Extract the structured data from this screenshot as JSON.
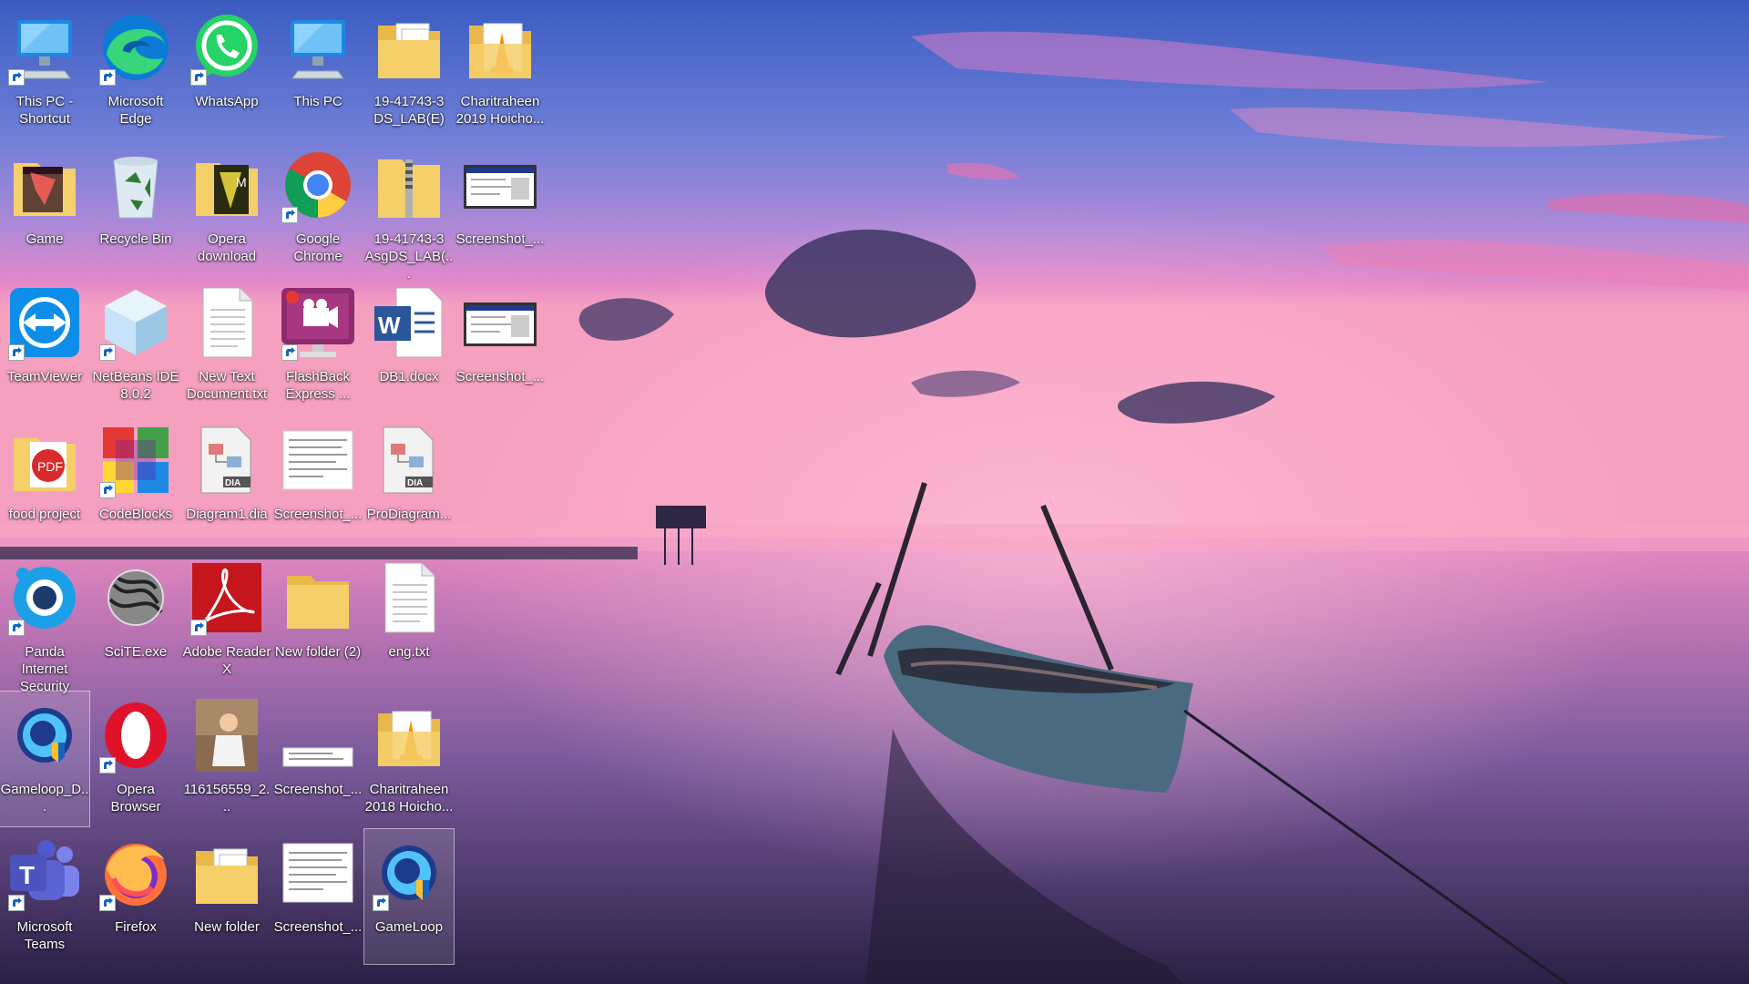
{
  "desktop": {
    "wallpaper": {
      "sky_top": "#3f5fb8",
      "sky_mid": "#b58ad6",
      "horizon": "#f07ab8",
      "water": "#6b4a8a",
      "water_dark": "#1e1630"
    },
    "columns": [
      [
        {
          "label": "This PC - Shortcut",
          "icon": "this-pc-icon",
          "shortcut": true
        },
        {
          "label": "Game",
          "icon": "folder-game-icon",
          "shortcut": false
        },
        {
          "label": "TeamViewer",
          "icon": "teamviewer-icon",
          "shortcut": true
        },
        {
          "label": "food project",
          "icon": "folder-pdf-icon",
          "shortcut": false
        },
        {
          "label": "Panda Internet Security",
          "icon": "panda-security-icon",
          "shortcut": true
        },
        {
          "label": "Gameloop_D...",
          "icon": "gameloop-icon",
          "shortcut": false,
          "selected": true
        },
        {
          "label": "Microsoft Teams",
          "icon": "teams-icon",
          "shortcut": true
        }
      ],
      [
        {
          "label": "Microsoft Edge",
          "icon": "edge-icon",
          "shortcut": true
        },
        {
          "label": "Recycle Bin",
          "icon": "recycle-bin-icon",
          "shortcut": false
        },
        {
          "label": "NetBeans IDE 8.0.2",
          "icon": "netbeans-icon",
          "shortcut": true
        },
        {
          "label": "CodeBlocks",
          "icon": "codeblocks-icon",
          "shortcut": true
        },
        {
          "label": "SciTE.exe",
          "icon": "scite-icon",
          "shortcut": false
        },
        {
          "label": "Opera Browser",
          "icon": "opera-icon",
          "shortcut": true
        },
        {
          "label": "Firefox",
          "icon": "firefox-icon",
          "shortcut": true
        }
      ],
      [
        {
          "label": "WhatsApp",
          "icon": "whatsapp-icon",
          "shortcut": true
        },
        {
          "label": "Opera download",
          "icon": "folder-opera-icon",
          "shortcut": false
        },
        {
          "label": "New Text Document.txt",
          "icon": "text-file-icon",
          "shortcut": false
        },
        {
          "label": "Diagram1.dia",
          "icon": "dia-file-icon",
          "shortcut": false
        },
        {
          "label": "Adobe Reader X",
          "icon": "adobe-reader-icon",
          "shortcut": true
        },
        {
          "label": "116156559_2...",
          "icon": "photo-thumbnail-icon",
          "shortcut": false
        },
        {
          "label": "New folder",
          "icon": "folder-docs-icon",
          "shortcut": false
        }
      ],
      [
        {
          "label": "This PC",
          "icon": "this-pc-icon",
          "shortcut": false
        },
        {
          "label": "Google Chrome",
          "icon": "chrome-icon",
          "shortcut": true
        },
        {
          "label": "FlashBack Express ...",
          "icon": "flashback-icon",
          "shortcut": true
        },
        {
          "label": "Screenshot_...",
          "icon": "screenshot-doc-icon",
          "shortcut": false
        },
        {
          "label": "New folder (2)",
          "icon": "folder-empty-icon",
          "shortcut": false
        },
        {
          "label": "Screenshot_...",
          "icon": "screenshot-strip-icon",
          "shortcut": false
        },
        {
          "label": "Screenshot_...",
          "icon": "screenshot-doc-icon",
          "shortcut": false
        }
      ],
      [
        {
          "label": "19-41743-3 DS_LAB(E)",
          "icon": "folder-docs-icon",
          "shortcut": false
        },
        {
          "label": "19-41743-3 AsgDS_LAB(...",
          "icon": "zip-folder-icon",
          "shortcut": false
        },
        {
          "label": "DB1.docx",
          "icon": "word-doc-icon",
          "shortcut": false
        },
        {
          "label": "ProDiagram...",
          "icon": "dia-file-icon",
          "shortcut": false
        },
        {
          "label": "eng.txt",
          "icon": "text-file-icon",
          "shortcut": false
        },
        {
          "label": "Charitraheen 2018 Hoicho...",
          "icon": "folder-vlc-icon",
          "shortcut": false
        },
        {
          "label": "GameLoop",
          "icon": "gameloop-icon",
          "shortcut": true,
          "selected": true
        }
      ],
      [
        {
          "label": "Charitraheen 2019 Hoicho...",
          "icon": "folder-vlc-icon",
          "shortcut": false
        },
        {
          "label": "Screenshot_...",
          "icon": "screenshot-window-icon",
          "shortcut": false
        },
        {
          "label": "Screenshot_...",
          "icon": "screenshot-window-icon",
          "shortcut": false
        }
      ]
    ]
  }
}
